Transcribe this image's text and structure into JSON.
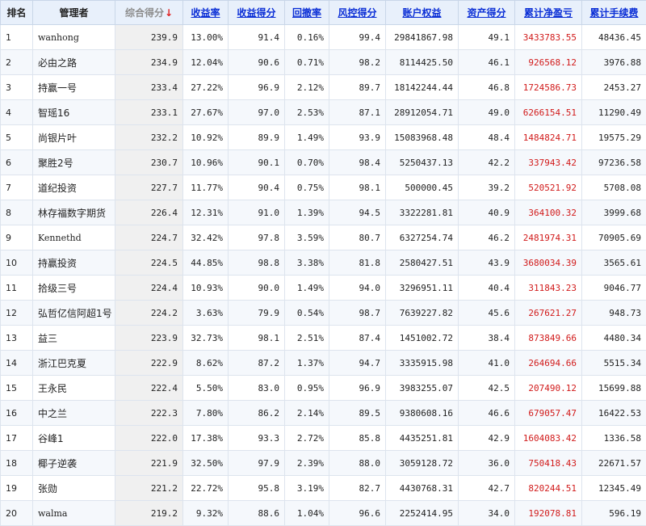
{
  "columns": [
    {
      "label": "排名",
      "style": "plain"
    },
    {
      "label": "管理者",
      "style": "plain"
    },
    {
      "label": "综合得分",
      "style": "sorted",
      "sort_indicator": "↓"
    },
    {
      "label": "收益率",
      "style": "link"
    },
    {
      "label": "收益得分",
      "style": "link"
    },
    {
      "label": "回撤率",
      "style": "link"
    },
    {
      "label": "风控得分",
      "style": "link"
    },
    {
      "label": "账户权益",
      "style": "link"
    },
    {
      "label": "资产得分",
      "style": "link"
    },
    {
      "label": "累计净盈亏",
      "style": "link"
    },
    {
      "label": "累计手续费",
      "style": "link"
    }
  ],
  "colors": {
    "header_bg": "#e8f0fb",
    "link": "#0b2fd6",
    "profit_text": "#d11a1a",
    "sort_arrow": "#e02020",
    "composite_bg": "#f0f0f0"
  },
  "rows": [
    {
      "rank": "1",
      "manager": "wanhong",
      "composite": "239.9",
      "return_rate": "13.00%",
      "return_score": "91.4",
      "drawdown": "0.16%",
      "risk_score": "99.4",
      "equity": "29841867.98",
      "asset_score": "49.1",
      "net_profit": "3433783.55",
      "fees": "48436.45"
    },
    {
      "rank": "2",
      "manager": "必由之路",
      "composite": "234.9",
      "return_rate": "12.04%",
      "return_score": "90.6",
      "drawdown": "0.71%",
      "risk_score": "98.2",
      "equity": "8114425.50",
      "asset_score": "46.1",
      "net_profit": "926568.12",
      "fees": "3976.88"
    },
    {
      "rank": "3",
      "manager": "持赢一号",
      "composite": "233.4",
      "return_rate": "27.22%",
      "return_score": "96.9",
      "drawdown": "2.12%",
      "risk_score": "89.7",
      "equity": "18142244.44",
      "asset_score": "46.8",
      "net_profit": "1724586.73",
      "fees": "2453.27"
    },
    {
      "rank": "4",
      "manager": "智瑶16",
      "composite": "233.1",
      "return_rate": "27.67%",
      "return_score": "97.0",
      "drawdown": "2.53%",
      "risk_score": "87.1",
      "equity": "28912054.71",
      "asset_score": "49.0",
      "net_profit": "6266154.51",
      "fees": "11290.49"
    },
    {
      "rank": "5",
      "manager": "尚银片叶",
      "composite": "232.2",
      "return_rate": "10.92%",
      "return_score": "89.9",
      "drawdown": "1.49%",
      "risk_score": "93.9",
      "equity": "15083968.48",
      "asset_score": "48.4",
      "net_profit": "1484824.71",
      "fees": "19575.29"
    },
    {
      "rank": "6",
      "manager": "聚胜2号",
      "composite": "230.7",
      "return_rate": "10.96%",
      "return_score": "90.1",
      "drawdown": "0.70%",
      "risk_score": "98.4",
      "equity": "5250437.13",
      "asset_score": "42.2",
      "net_profit": "337943.42",
      "fees": "97236.58"
    },
    {
      "rank": "7",
      "manager": "道纪投资",
      "composite": "227.7",
      "return_rate": "11.77%",
      "return_score": "90.4",
      "drawdown": "0.75%",
      "risk_score": "98.1",
      "equity": "500000.45",
      "asset_score": "39.2",
      "net_profit": "520521.92",
      "fees": "5708.08"
    },
    {
      "rank": "8",
      "manager": "林存福数字期货",
      "composite": "226.4",
      "return_rate": "12.31%",
      "return_score": "91.0",
      "drawdown": "1.39%",
      "risk_score": "94.5",
      "equity": "3322281.81",
      "asset_score": "40.9",
      "net_profit": "364100.32",
      "fees": "3999.68"
    },
    {
      "rank": "9",
      "manager": "Kennethd",
      "composite": "224.7",
      "return_rate": "32.42%",
      "return_score": "97.8",
      "drawdown": "3.59%",
      "risk_score": "80.7",
      "equity": "6327254.74",
      "asset_score": "46.2",
      "net_profit": "2481974.31",
      "fees": "70905.69"
    },
    {
      "rank": "10",
      "manager": "持赢投资",
      "composite": "224.5",
      "return_rate": "44.85%",
      "return_score": "98.8",
      "drawdown": "3.38%",
      "risk_score": "81.8",
      "equity": "2580427.51",
      "asset_score": "43.9",
      "net_profit": "3680034.39",
      "fees": "3565.61"
    },
    {
      "rank": "11",
      "manager": "拾级三号",
      "composite": "224.4",
      "return_rate": "10.93%",
      "return_score": "90.0",
      "drawdown": "1.49%",
      "risk_score": "94.0",
      "equity": "3296951.11",
      "asset_score": "40.4",
      "net_profit": "311843.23",
      "fees": "9046.77"
    },
    {
      "rank": "12",
      "manager": "弘哲亿信阿超1号",
      "composite": "224.2",
      "return_rate": "3.63%",
      "return_score": "79.9",
      "drawdown": "0.54%",
      "risk_score": "98.7",
      "equity": "7639227.82",
      "asset_score": "45.6",
      "net_profit": "267621.27",
      "fees": "948.73"
    },
    {
      "rank": "13",
      "manager": "益三",
      "composite": "223.9",
      "return_rate": "32.73%",
      "return_score": "98.1",
      "drawdown": "2.51%",
      "risk_score": "87.4",
      "equity": "1451002.72",
      "asset_score": "38.4",
      "net_profit": "873849.66",
      "fees": "4480.34"
    },
    {
      "rank": "14",
      "manager": "浙江巴克夏",
      "composite": "222.9",
      "return_rate": "8.62%",
      "return_score": "87.2",
      "drawdown": "1.37%",
      "risk_score": "94.7",
      "equity": "3335915.98",
      "asset_score": "41.0",
      "net_profit": "264694.66",
      "fees": "5515.34"
    },
    {
      "rank": "15",
      "manager": "王永民",
      "composite": "222.4",
      "return_rate": "5.50%",
      "return_score": "83.0",
      "drawdown": "0.95%",
      "risk_score": "96.9",
      "equity": "3983255.07",
      "asset_score": "42.5",
      "net_profit": "207490.12",
      "fees": "15699.88"
    },
    {
      "rank": "16",
      "manager": "中之兰",
      "composite": "222.3",
      "return_rate": "7.80%",
      "return_score": "86.2",
      "drawdown": "2.14%",
      "risk_score": "89.5",
      "equity": "9380608.16",
      "asset_score": "46.6",
      "net_profit": "679057.47",
      "fees": "16422.53"
    },
    {
      "rank": "17",
      "manager": "谷峰1",
      "composite": "222.0",
      "return_rate": "17.38%",
      "return_score": "93.3",
      "drawdown": "2.72%",
      "risk_score": "85.8",
      "equity": "4435251.81",
      "asset_score": "42.9",
      "net_profit": "1604083.42",
      "fees": "1336.58"
    },
    {
      "rank": "18",
      "manager": "椰子逆袭",
      "composite": "221.9",
      "return_rate": "32.50%",
      "return_score": "97.9",
      "drawdown": "2.39%",
      "risk_score": "88.0",
      "equity": "3059128.72",
      "asset_score": "36.0",
      "net_profit": "750418.43",
      "fees": "22671.57"
    },
    {
      "rank": "19",
      "manager": "张勋",
      "composite": "221.2",
      "return_rate": "22.72%",
      "return_score": "95.8",
      "drawdown": "3.19%",
      "risk_score": "82.7",
      "equity": "4430768.31",
      "asset_score": "42.7",
      "net_profit": "820244.51",
      "fees": "12345.49"
    },
    {
      "rank": "20",
      "manager": "walma",
      "composite": "219.2",
      "return_rate": "9.32%",
      "return_score": "88.6",
      "drawdown": "1.04%",
      "risk_score": "96.6",
      "equity": "2252414.95",
      "asset_score": "34.0",
      "net_profit": "192078.81",
      "fees": "596.19"
    }
  ]
}
